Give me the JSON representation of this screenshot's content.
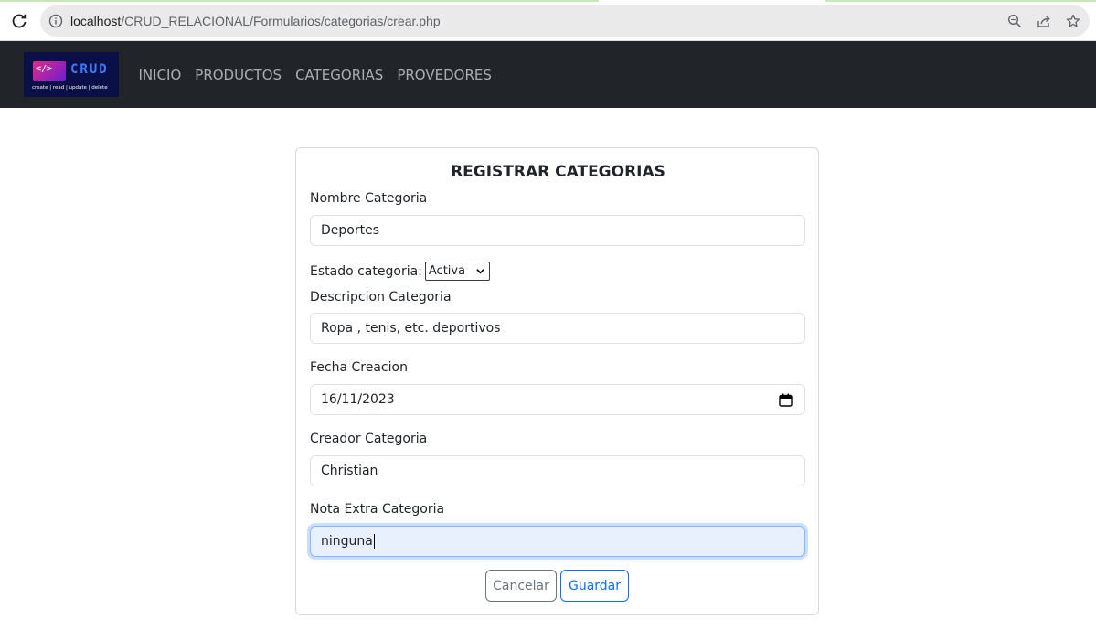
{
  "browser": {
    "url_host": "localhost",
    "url_path": "/CRUD_RELACIONAL/Formularios/categorias/crear.php"
  },
  "navbar": {
    "logo": {
      "code_glyph": "</>",
      "brand": "CRUD",
      "tagline": "create | read | update | delete"
    },
    "links": [
      "INICIO",
      "PRODUCTOS",
      "CATEGORIAS",
      "PROVEDORES"
    ]
  },
  "form": {
    "title": "REGISTRAR CATEGORIAS",
    "nombre": {
      "label": "Nombre Categoria",
      "value": "Deportes"
    },
    "estado": {
      "label": "Estado categoria:",
      "selected": "Activa"
    },
    "descripcion": {
      "label": "Descripcion Categoria",
      "value": "Ropa , tenis, etc. deportivos"
    },
    "fecha": {
      "label": "Fecha Creacion",
      "value": "16/11/2023"
    },
    "creador": {
      "label": "Creador Categoria",
      "value": "Christian"
    },
    "nota": {
      "label": "Nota Extra Categoria",
      "value": "ninguna"
    },
    "cancel_label": "Cancelar",
    "save_label": "Guardar"
  },
  "colors": {
    "navbar_bg": "#212529",
    "primary": "#0d6efd",
    "secondary": "#6c757d",
    "focus_bg": "#e8f0fe"
  }
}
